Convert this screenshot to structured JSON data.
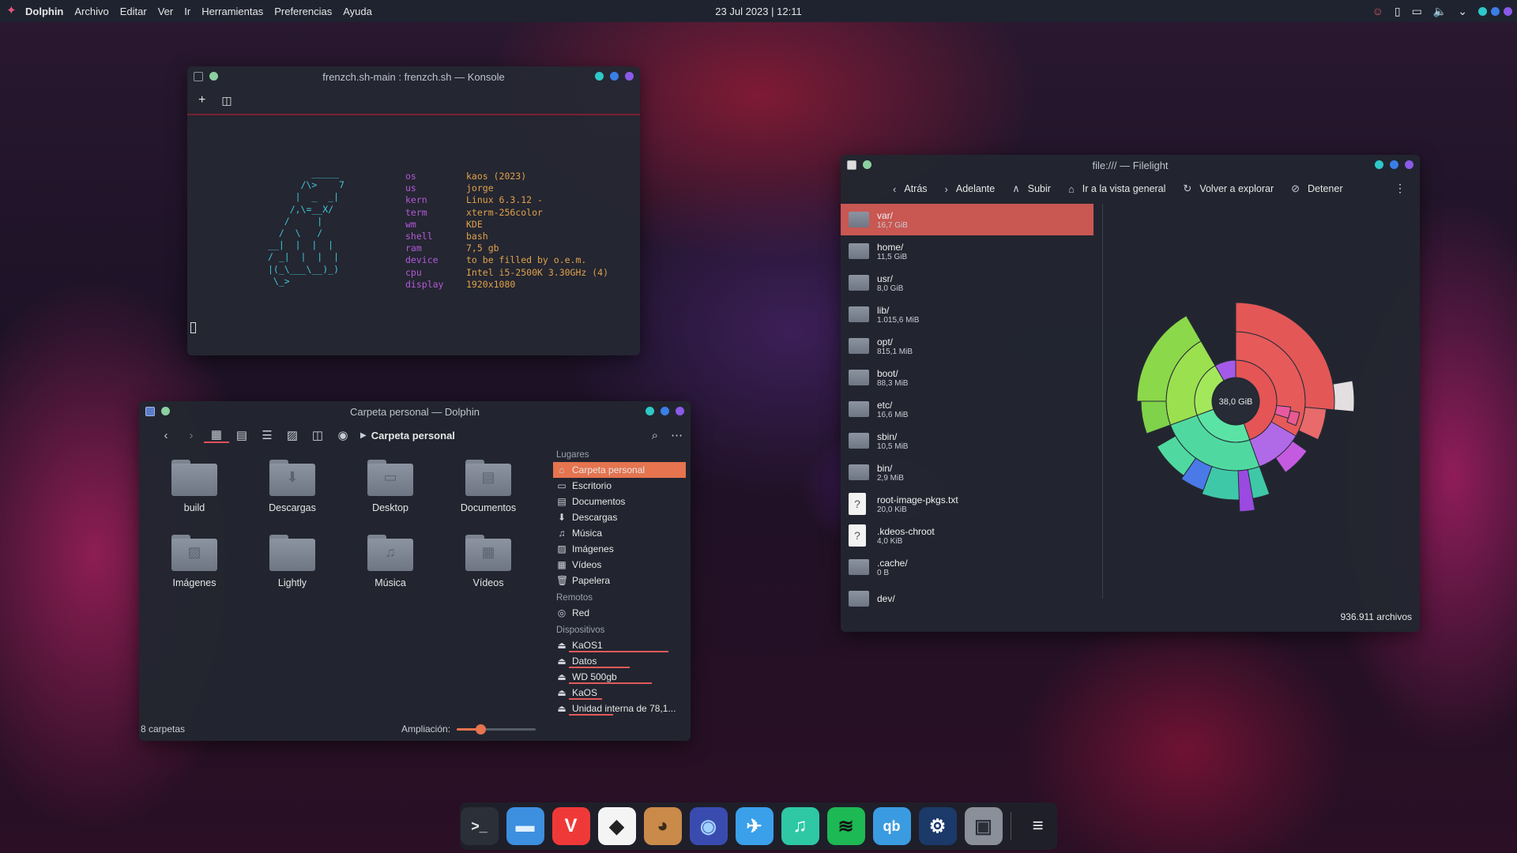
{
  "topbar": {
    "app_name": "Dolphin",
    "menus": [
      "Archivo",
      "Editar",
      "Ver",
      "Ir",
      "Herramientas",
      "Preferencias",
      "Ayuda"
    ],
    "clock": "23 Jul 2023 | 12:11"
  },
  "konsole": {
    "title": "frenzch.sh-main : frenzch.sh — Konsole",
    "ascii": "        _____\n      /\\>    7\n     |  _  _|\n    /,\\=__X/\n   /     |\n  /  \\   /\n__|  |  |  |\n/ _|  |  |  |\n|(_\\___\\__)_)\n \\_>",
    "info": [
      {
        "k": "os",
        "v": "kaos (2023)"
      },
      {
        "k": "us",
        "v": "jorge"
      },
      {
        "k": "kern",
        "v": "Linux 6.3.12 -"
      },
      {
        "k": "term",
        "v": "xterm-256color"
      },
      {
        "k": "wm",
        "v": "KDE"
      },
      {
        "k": "shell",
        "v": "bash"
      },
      {
        "k": "ram",
        "v": "7,5 gb"
      },
      {
        "k": "device",
        "v": "to be filled by o.e.m."
      },
      {
        "k": "cpu",
        "v": "Intel i5-2500K 3.30GHz (4)"
      },
      {
        "k": "display",
        "v": "1920x1080"
      }
    ]
  },
  "dolphin": {
    "title": "Carpeta personal — Dolphin",
    "breadcrumb": "Carpeta personal",
    "items": [
      {
        "label": "build",
        "glyph": ""
      },
      {
        "label": "Descargas",
        "glyph": "⬇"
      },
      {
        "label": "Desktop",
        "glyph": "▭"
      },
      {
        "label": "Documentos",
        "glyph": "▤"
      },
      {
        "label": "Imágenes",
        "glyph": "▨"
      },
      {
        "label": "Lightly",
        "glyph": ""
      },
      {
        "label": "Música",
        "glyph": "♫"
      },
      {
        "label": "Vídeos",
        "glyph": "▦"
      }
    ],
    "places_header": "Lugares",
    "places": [
      {
        "label": "Carpeta personal",
        "icon": "⌂"
      },
      {
        "label": "Escritorio",
        "icon": "▭"
      },
      {
        "label": "Documentos",
        "icon": "▤"
      },
      {
        "label": "Descargas",
        "icon": "⬇"
      },
      {
        "label": "Música",
        "icon": "♫"
      },
      {
        "label": "Imágenes",
        "icon": "▨"
      },
      {
        "label": "Vídeos",
        "icon": "▦"
      },
      {
        "label": "Papelera",
        "icon": "🗑"
      }
    ],
    "remote_header": "Remotos",
    "remote": [
      {
        "label": "Red",
        "icon": "◎"
      }
    ],
    "devices_header": "Dispositivos",
    "devices": [
      {
        "label": "KaOS1",
        "usage": 0.9
      },
      {
        "label": "Datos",
        "usage": 0.55
      },
      {
        "label": "WD 500gb",
        "usage": 0.75
      },
      {
        "label": "KaOS",
        "usage": 0.3
      },
      {
        "label": "Unidad interna de 78,1...",
        "usage": 0.4
      }
    ],
    "status": "8 carpetas",
    "zoom_label": "Ampliación:",
    "zoom_value": 0.3
  },
  "filelight": {
    "title": "file:/// — Filelight",
    "toolbar": [
      {
        "icon": "‹",
        "label": "Atrás"
      },
      {
        "icon": "›",
        "label": "Adelante"
      },
      {
        "icon": "∧",
        "label": "Subir"
      },
      {
        "icon": "⌂",
        "label": "Ir a la vista general"
      },
      {
        "icon": "↻",
        "label": "Volver a explorar"
      },
      {
        "icon": "⊘",
        "label": "Detener"
      }
    ],
    "entries": [
      {
        "name": "var/",
        "size": "16,7 GiB"
      },
      {
        "name": "home/",
        "size": "11,5 GiB"
      },
      {
        "name": "usr/",
        "size": "8,0 GiB"
      },
      {
        "name": "lib/",
        "size": "1.015,6 MiB"
      },
      {
        "name": "opt/",
        "size": "815,1 MiB"
      },
      {
        "name": "boot/",
        "size": "88,3 MiB"
      },
      {
        "name": "etc/",
        "size": "16,6 MiB"
      },
      {
        "name": "sbin/",
        "size": "10,5 MiB"
      },
      {
        "name": "bin/",
        "size": "2,9 MiB"
      },
      {
        "name": "root-image-pkgs.txt",
        "size": "20,0 KiB"
      },
      {
        "name": ".kdeos-chroot",
        "size": "4,0 KiB"
      },
      {
        "name": ".cache/",
        "size": "0 B"
      },
      {
        "name": "dev/",
        "size": ""
      }
    ],
    "center_label": "38,0 GiB",
    "file_count": "936.911 archivos"
  },
  "dock": [
    {
      "name": "konsole",
      "glyph": ">_",
      "bg": "#2b2f38",
      "fg": "#e6e6e6"
    },
    {
      "name": "dolphin",
      "glyph": "▬",
      "bg": "#3d8fe0",
      "fg": "#dff0ff"
    },
    {
      "name": "vivaldi",
      "glyph": "V",
      "bg": "#ef3939",
      "fg": "#ffffff"
    },
    {
      "name": "inkscape",
      "glyph": "◆",
      "bg": "#f4f4f4",
      "fg": "#222222"
    },
    {
      "name": "gimp",
      "glyph": "◕",
      "bg": "#c98a4a",
      "fg": "#3a2a1a"
    },
    {
      "name": "keepass",
      "glyph": "◉",
      "bg": "#3a4bb0",
      "fg": "#9fd0ff"
    },
    {
      "name": "kde-connect",
      "glyph": "✈",
      "bg": "#3aa0ea",
      "fg": "#ffffff"
    },
    {
      "name": "music",
      "glyph": "♫",
      "bg": "#2ec8a5",
      "fg": "#ffffff"
    },
    {
      "name": "spotify",
      "glyph": "≋",
      "bg": "#1db954",
      "fg": "#111111"
    },
    {
      "name": "qbittorrent",
      "glyph": "qb",
      "bg": "#3b9be0",
      "fg": "#ffffff"
    },
    {
      "name": "steam",
      "glyph": "⚙",
      "bg": "#1b3a6a",
      "fg": "#ffffff"
    },
    {
      "name": "drive",
      "glyph": "▣",
      "bg": "#8a8f99",
      "fg": "#2b2f38"
    },
    {
      "name": "menu",
      "glyph": "≡",
      "bg": "transparent",
      "fg": "#e6e6e6"
    }
  ],
  "colors": {
    "accent": "#e5744f",
    "red": "#e0505a"
  }
}
